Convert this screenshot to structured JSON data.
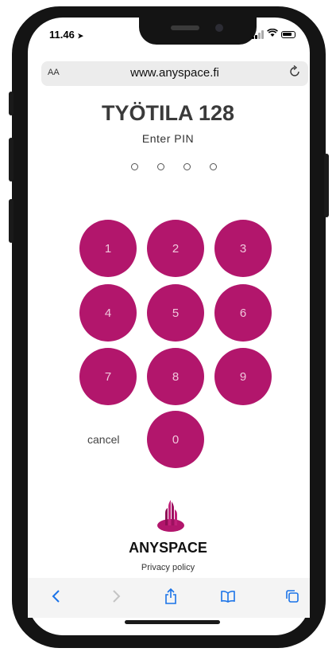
{
  "status": {
    "time": "11.46"
  },
  "browser": {
    "aa_label": "AA",
    "url": "www.anyspace.fi"
  },
  "page": {
    "title": "TYÖTILA 128",
    "subtitle": "Enter PIN",
    "pin_length": 4
  },
  "keypad": {
    "keys": [
      "1",
      "2",
      "3",
      "4",
      "5",
      "6",
      "7",
      "8",
      "9",
      "0"
    ],
    "cancel_label": "cancel",
    "key_color": "#b2166c"
  },
  "footer": {
    "brand": "ANYSPACE",
    "privacy_label": "Privacy policy"
  },
  "toolbar": {
    "icons": [
      "back-icon",
      "forward-icon",
      "share-icon",
      "bookmarks-icon",
      "tabs-icon"
    ],
    "accent": "#1a73e8"
  }
}
